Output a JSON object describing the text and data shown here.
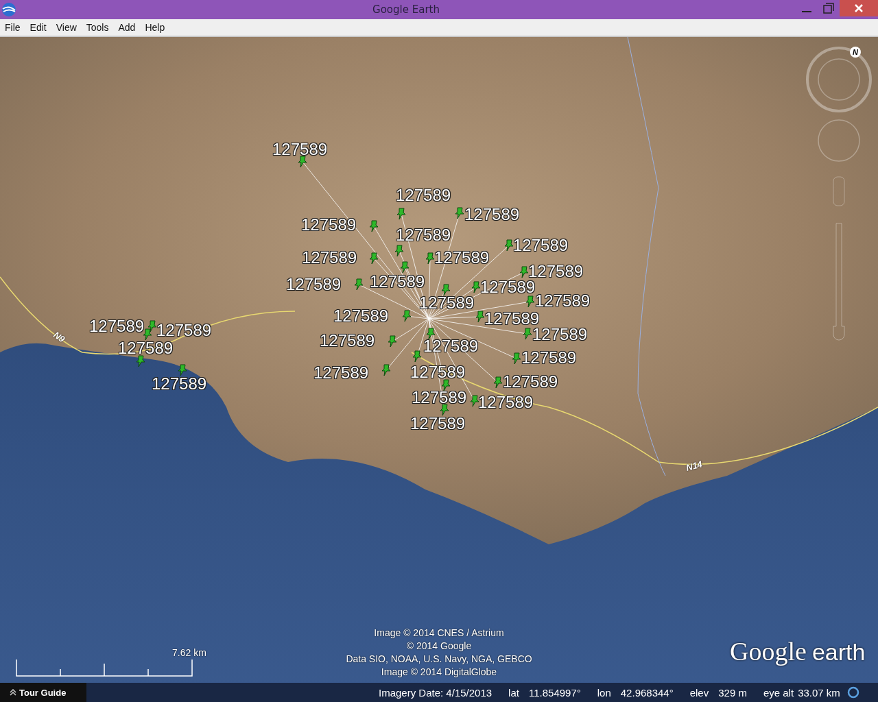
{
  "window": {
    "title": "Google Earth"
  },
  "menu": [
    "File",
    "Edit",
    "View",
    "Tools",
    "Add",
    "Help"
  ],
  "map": {
    "placemarks": [
      {
        "label": "127589"
      },
      {
        "label": "127589"
      },
      {
        "label": "127589"
      },
      {
        "label": "127589"
      },
      {
        "label": "127589"
      },
      {
        "label": "127589"
      },
      {
        "label": "127589"
      },
      {
        "label": "127589"
      },
      {
        "label": "127589"
      },
      {
        "label": "127589"
      },
      {
        "label": "127589"
      },
      {
        "label": "127589"
      },
      {
        "label": "127589"
      },
      {
        "label": "127589"
      },
      {
        "label": "127589"
      },
      {
        "label": "127589"
      },
      {
        "label": "127589"
      },
      {
        "label": "127589"
      },
      {
        "label": "127589"
      },
      {
        "label": "127589"
      },
      {
        "label": "127589"
      },
      {
        "label": "127589"
      },
      {
        "label": "127589"
      },
      {
        "label": "127589"
      },
      {
        "label": "127589"
      },
      {
        "label": "127589"
      },
      {
        "label": "127589"
      },
      {
        "label": "127589"
      },
      {
        "label": "127589"
      },
      {
        "label": "127589"
      }
    ],
    "road_labels": [
      "N9",
      "N14"
    ],
    "compass": {
      "north": "N"
    },
    "scale": {
      "label": "7.62 km"
    },
    "attribution": [
      "Image © 2014 CNES / Astrium",
      "© 2014 Google",
      "Data SIO, NOAA, U.S. Navy, NGA, GEBCO",
      "Image © 2014 DigitalGlobe"
    ],
    "logo": {
      "word_1": "Google",
      "word_2": "earth"
    }
  },
  "tour_guide": {
    "label": "Tour Guide"
  },
  "status_bar": {
    "imagery_date": "Imagery Date: 4/15/2013",
    "fields": [
      {
        "label": "lat",
        "value": "11.854997°"
      },
      {
        "label": "lon",
        "value": "42.968344°"
      },
      {
        "label": "elev",
        "value": "329 m"
      },
      {
        "label": "eye alt",
        "value": "33.07 km"
      }
    ]
  }
}
